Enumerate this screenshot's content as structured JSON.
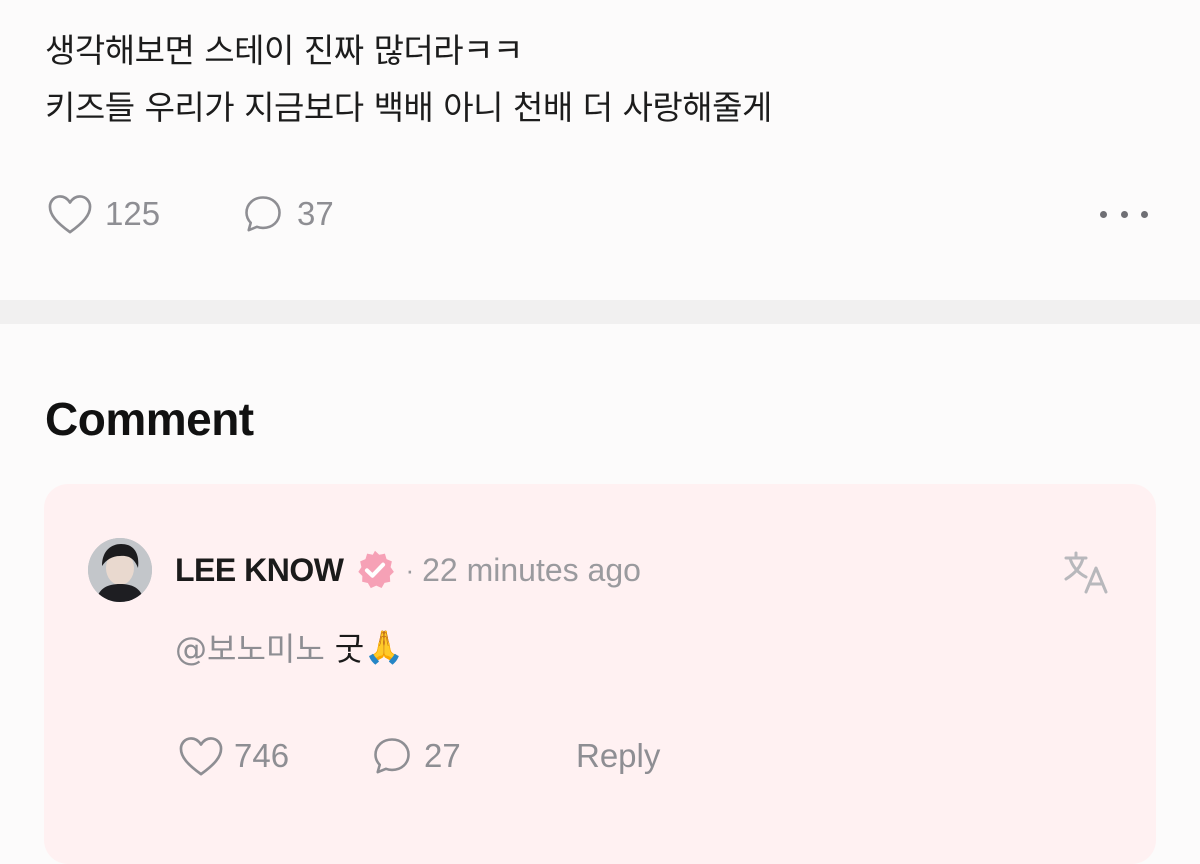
{
  "post": {
    "text_lines": [
      "생각해보면 스테이 진짜 많더라ㅋㅋ",
      "키즈들 우리가 지금보다 백배 아니 천배 더 사랑해줄게"
    ],
    "likes": "125",
    "comments": "37",
    "icons": {
      "like": "heart-outline-icon",
      "comment": "speech-bubble-icon",
      "more": "more-horizontal-icon"
    }
  },
  "comments_section": {
    "title": "Comment",
    "comments": [
      {
        "author": "LEE KNOW",
        "verified": true,
        "separator": "·",
        "time": "22 minutes ago",
        "mention": "@보노미노",
        "text": "굿",
        "emoji": "🙏",
        "likes": "746",
        "replies": "27",
        "reply_label": "Reply",
        "translate_icon": "translate-icon"
      }
    ]
  },
  "colors": {
    "background": "#fcfbfb",
    "divider": "#f1f0f0",
    "comment_card": "#fff1f2",
    "badge": "#f6a1b6",
    "muted_text": "#8e8e93"
  }
}
